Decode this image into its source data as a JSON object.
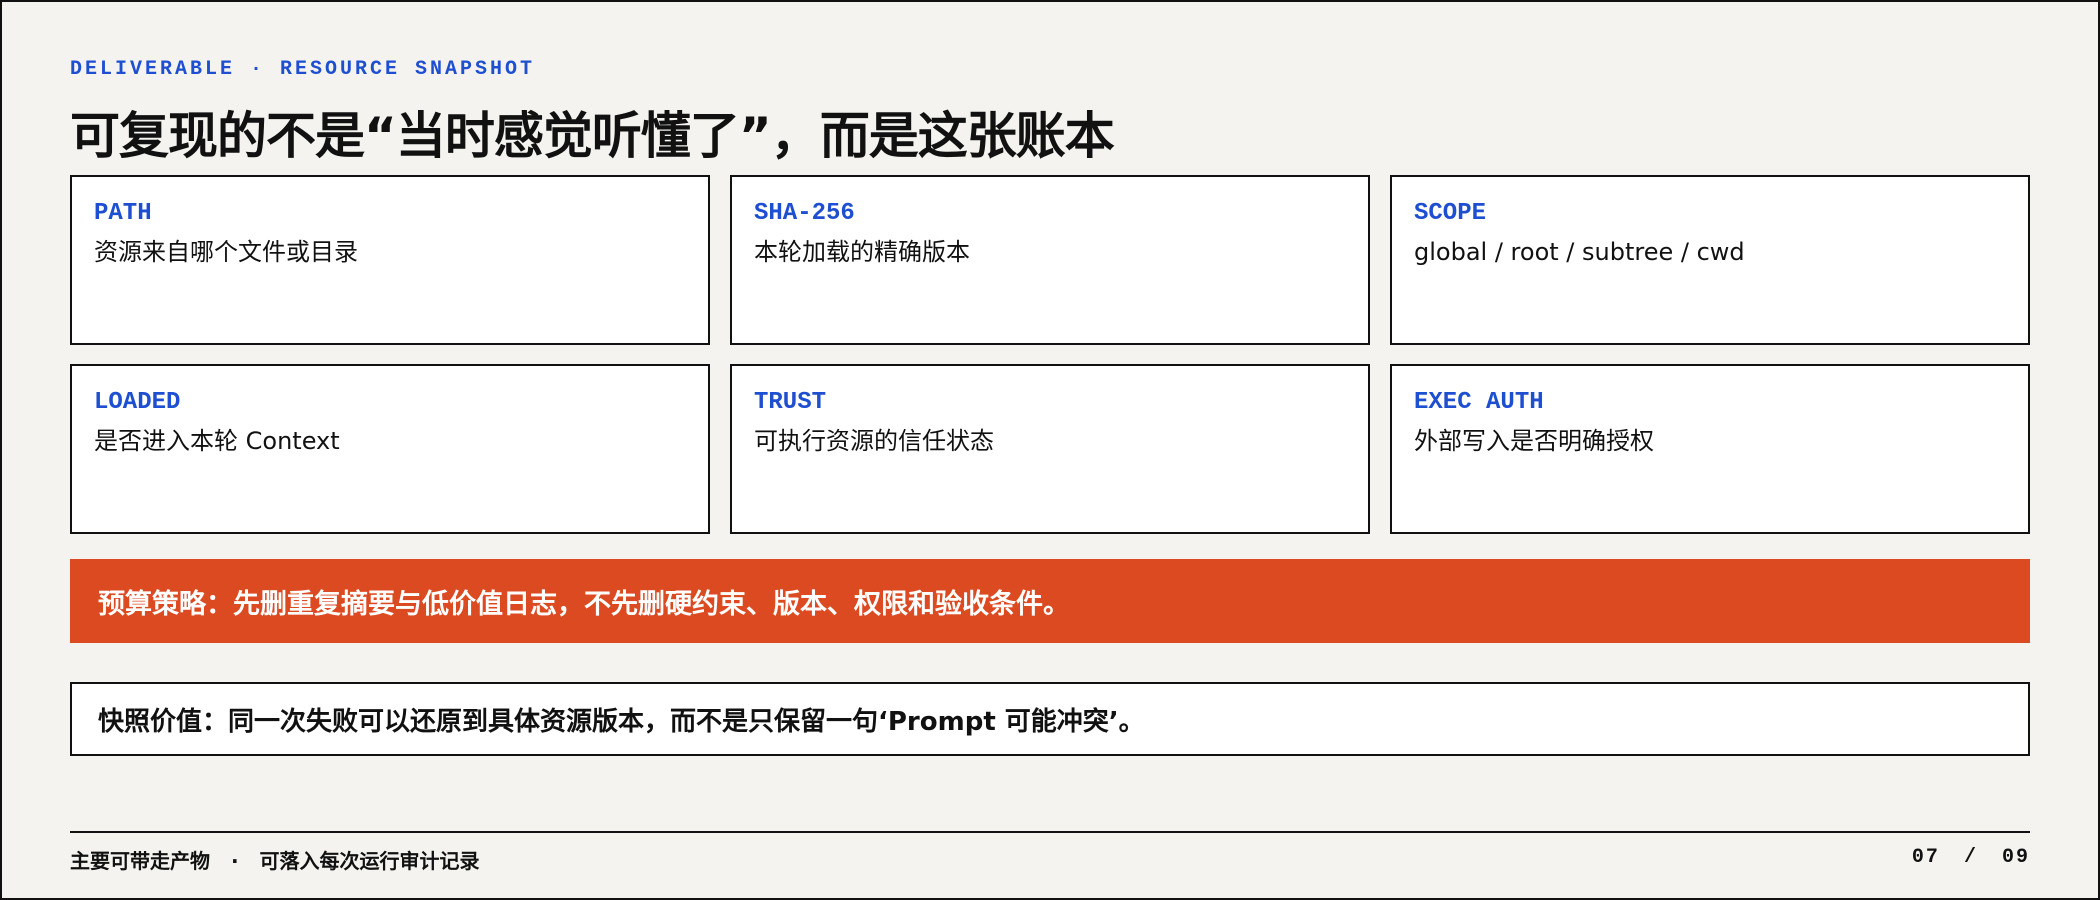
{
  "header": {
    "eyebrow": "DELIVERABLE · RESOURCE SNAPSHOT",
    "title": "可复现的不是“当时感觉听懂了”，而是这张账本"
  },
  "cards": [
    {
      "label": "PATH",
      "desc": "资源来自哪个文件或目录"
    },
    {
      "label": "SHA-256",
      "desc": "本轮加载的精确版本"
    },
    {
      "label": "SCOPE",
      "desc": "global / root / subtree / cwd"
    },
    {
      "label": "LOADED",
      "desc": "是否进入本轮 Context"
    },
    {
      "label": "TRUST",
      "desc": "可执行资源的信任状态"
    },
    {
      "label": "EXEC AUTH",
      "desc": "外部写入是否明确授权"
    }
  ],
  "banner": {
    "text": "预算策略：先删重复摘要与低价值日志，不先删硬约束、版本、权限和验收条件。"
  },
  "note": {
    "text": "快照价值：同一次失败可以还原到具体资源版本，而不是只保留一句‘Prompt 可能冲突’。"
  },
  "footer": {
    "left_a": "主要可带走产物",
    "separator": "·",
    "left_b": "可落入每次运行审计记录",
    "page_current": "07",
    "page_sep": "/",
    "page_total": "09"
  },
  "colors": {
    "accent_blue": "#1f4fd1",
    "banner_orange": "#dc4a22",
    "background": "#f4f3ef",
    "ink": "#111111"
  }
}
